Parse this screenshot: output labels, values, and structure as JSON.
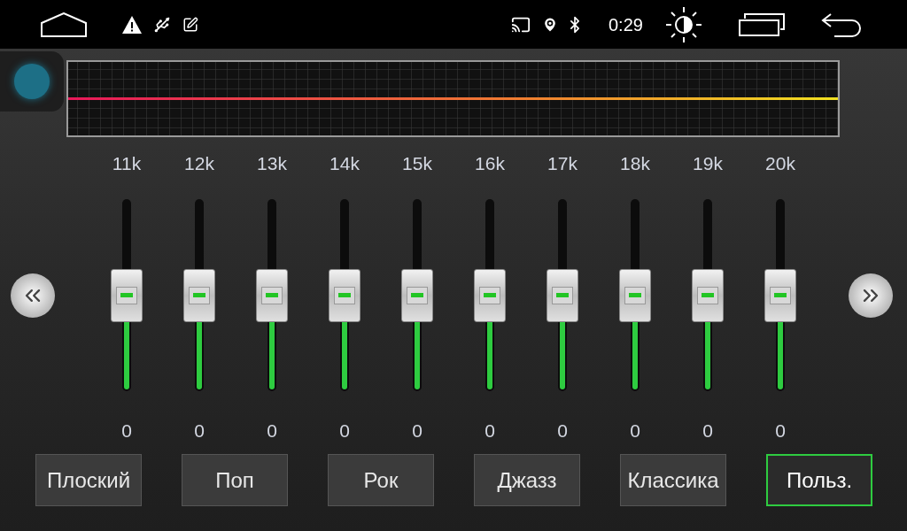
{
  "status_bar": {
    "time": "0:29"
  },
  "bands": [
    {
      "label": "11k",
      "value": "0",
      "level": 0.5
    },
    {
      "label": "12k",
      "value": "0",
      "level": 0.5
    },
    {
      "label": "13k",
      "value": "0",
      "level": 0.5
    },
    {
      "label": "14k",
      "value": "0",
      "level": 0.5
    },
    {
      "label": "15k",
      "value": "0",
      "level": 0.5
    },
    {
      "label": "16k",
      "value": "0",
      "level": 0.5
    },
    {
      "label": "17k",
      "value": "0",
      "level": 0.5
    },
    {
      "label": "18k",
      "value": "0",
      "level": 0.5
    },
    {
      "label": "19k",
      "value": "0",
      "level": 0.5
    },
    {
      "label": "20k",
      "value": "0",
      "level": 0.5
    }
  ],
  "presets": [
    {
      "label": "Плоский",
      "selected": false
    },
    {
      "label": "Поп",
      "selected": false
    },
    {
      "label": "Рок",
      "selected": false
    },
    {
      "label": "Джазз",
      "selected": false
    },
    {
      "label": "Классика",
      "selected": false
    },
    {
      "label": "Польз.",
      "selected": true
    }
  ]
}
